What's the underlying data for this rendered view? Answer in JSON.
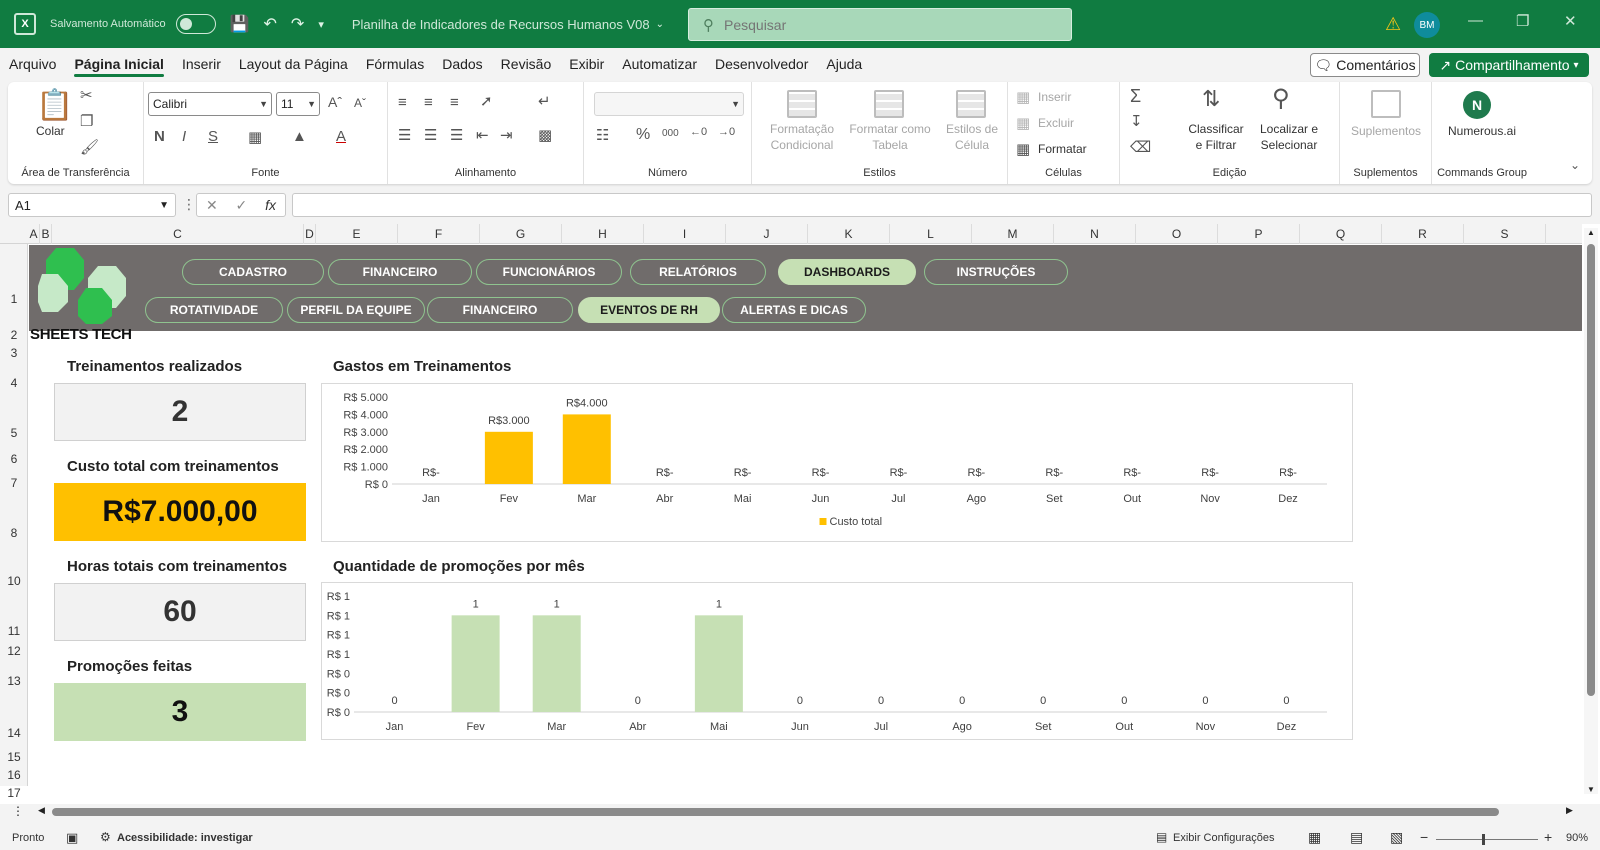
{
  "titlebar": {
    "app_icon": "excel-icon",
    "autosave_label": "Salvamento Automático",
    "file_title": "Planilha de Indicadores de Recursos Humanos V08",
    "search_placeholder": "Pesquisar",
    "avatar_initials": "BM"
  },
  "menu": {
    "tabs": [
      "Arquivo",
      "Página Inicial",
      "Inserir",
      "Layout da Página",
      "Fórmulas",
      "Dados",
      "Revisão",
      "Exibir",
      "Automatizar",
      "Desenvolvedor",
      "Ajuda"
    ],
    "active_tab": "Página Inicial",
    "comments_label": "Comentários",
    "share_label": "Compartilhamento"
  },
  "ribbon": {
    "clipboard": {
      "paste_label": "Colar",
      "group_label": "Área de Transferência"
    },
    "font": {
      "font_name": "Calibri",
      "font_size": "11",
      "bold": "N",
      "italic": "I",
      "underline": "S",
      "group_label": "Fonte"
    },
    "alignment": {
      "group_label": "Alinhamento"
    },
    "number": {
      "percent": "%",
      "thousands": "000",
      "group_label": "Número"
    },
    "styles": {
      "conditional": [
        "Formatação",
        "Condicional"
      ],
      "as_table": [
        "Formatar como",
        "Tabela"
      ],
      "cell_styles": [
        "Estilos de",
        "Célula"
      ],
      "group_label": "Estilos"
    },
    "cells": {
      "insert": "Inserir",
      "delete": "Excluir",
      "format": "Formatar",
      "group_label": "Células"
    },
    "editing": {
      "sort": [
        "Classificar",
        "e Filtrar"
      ],
      "find": [
        "Localizar e",
        "Selecionar"
      ],
      "group_label": "Edição"
    },
    "addins": {
      "label": "Suplementos",
      "group_label": "Suplementos"
    },
    "commands": {
      "label": "Numerous.ai",
      "group_label": "Commands Group"
    }
  },
  "formula_bar": {
    "name_box": "A1",
    "fx": "fx"
  },
  "columns": [
    "A",
    "B",
    "C",
    "D",
    "E",
    "F",
    "G",
    "H",
    "I",
    "J",
    "K",
    "L",
    "M",
    "N",
    "O",
    "P",
    "Q",
    "R",
    "S"
  ],
  "rows": [
    "1",
    "2",
    "3",
    "4",
    "5",
    "6",
    "7",
    "8",
    "10",
    "11",
    "12",
    "13",
    "14",
    "15",
    "16",
    "17"
  ],
  "dashboard": {
    "brand": "SHEETS TECH",
    "nav_top": [
      "CADASTRO",
      "FINANCEIRO",
      "FUNCIONÁRIOS",
      "RELATÓRIOS",
      "DASHBOARDS",
      "INSTRUÇÕES"
    ],
    "nav_top_active": "DASHBOARDS",
    "nav_sub": [
      "ROTATIVIDADE",
      "PERFIL DA EQUIPE",
      "FINANCEIRO",
      "EVENTOS DE RH",
      "ALERTAS E DICAS"
    ],
    "nav_sub_active": "EVENTOS DE RH",
    "kpis": [
      {
        "title": "Treinamentos realizados",
        "value": "2",
        "color": "#f2f2f2"
      },
      {
        "title": "Custo total com treinamentos",
        "value": "R$7.000,00",
        "color": "#ffc000"
      },
      {
        "title": "Horas totais com treinamentos",
        "value": "60",
        "color": "#f2f2f2"
      },
      {
        "title": "Promoções feitas",
        "value": "3",
        "color": "#c6e0b4"
      }
    ]
  },
  "chart_data": [
    {
      "type": "bar",
      "title": "Gastos em Treinamentos",
      "categories": [
        "Jan",
        "Fev",
        "Mar",
        "Abr",
        "Mai",
        "Jun",
        "Jul",
        "Ago",
        "Set",
        "Out",
        "Nov",
        "Dez"
      ],
      "series": [
        {
          "name": "Custo total",
          "values": [
            0,
            3000,
            4000,
            0,
            0,
            0,
            0,
            0,
            0,
            0,
            0,
            0
          ],
          "color": "#ffc000"
        }
      ],
      "data_labels": [
        "R$-",
        "R$3.000",
        "R$4.000",
        "R$-",
        "R$-",
        "R$-",
        "R$-",
        "R$-",
        "R$-",
        "R$-",
        "R$-",
        "R$-"
      ],
      "y_ticks": [
        "R$ 0",
        "R$ 1.000",
        "R$ 2.000",
        "R$ 3.000",
        "R$ 4.000",
        "R$ 5.000"
      ],
      "ylim": [
        0,
        5000
      ],
      "legend": "bottom"
    },
    {
      "type": "bar",
      "title": "Quantidade de promoções por mês",
      "categories": [
        "Jan",
        "Fev",
        "Mar",
        "Abr",
        "Mai",
        "Jun",
        "Jul",
        "Ago",
        "Set",
        "Out",
        "Nov",
        "Dez"
      ],
      "series": [
        {
          "values": [
            0,
            1,
            1,
            0,
            1,
            0,
            0,
            0,
            0,
            0,
            0,
            0
          ],
          "color": "#c6e0b4"
        }
      ],
      "data_labels": [
        "0",
        "1",
        "1",
        "0",
        "1",
        "0",
        "0",
        "0",
        "0",
        "0",
        "0",
        "0"
      ],
      "y_ticks": [
        "R$ 0",
        "R$ 0",
        "R$ 0",
        "R$ 1",
        "R$ 1",
        "R$ 1",
        "R$ 1"
      ],
      "ylim": [
        0,
        1.2
      ]
    }
  ],
  "statusbar": {
    "mode": "Pronto",
    "accessibility": "Acessibilidade: investigar",
    "display_settings": "Exibir Configurações",
    "zoom": "90%"
  }
}
